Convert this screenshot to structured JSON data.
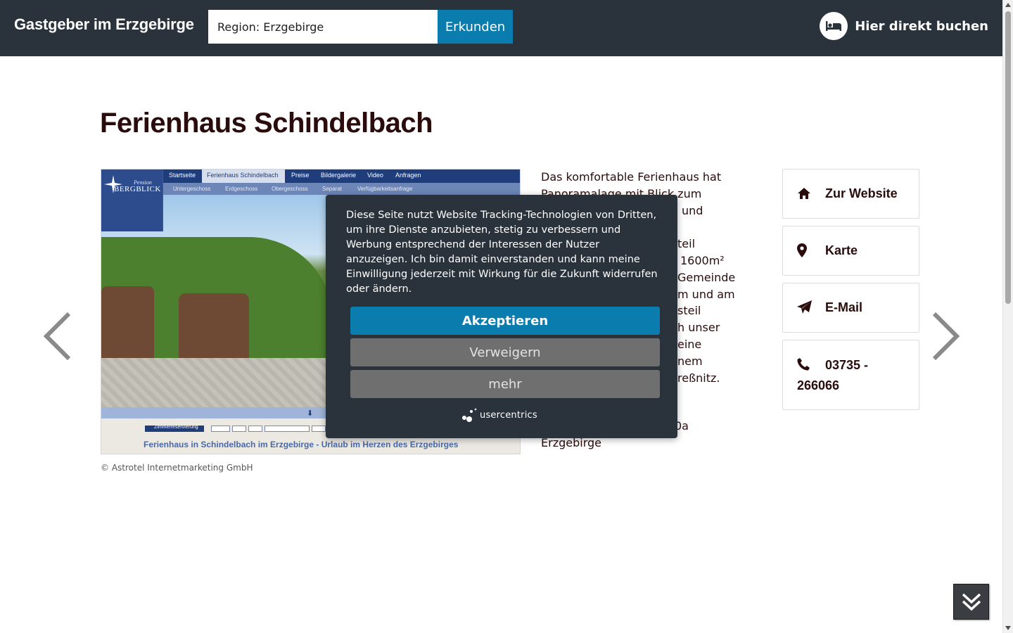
{
  "header": {
    "brand": "Gastgeber im Erzgebirge",
    "search_value": "Region: Erzgebirge",
    "search_button": "Erkunden",
    "book_label": "Hier direkt buchen"
  },
  "main": {
    "title": "Ferienhaus Schindelbach",
    "copyright": "© Astrotel Internetmarketing GmbH",
    "description_visible_lines": [
      "Das komfortable Ferienhaus hat",
      "Panoramalage mit Blick zum",
      "und",
      "",
      "teil",
      "1600m²",
      "Gemeinde",
      "m und am",
      "steil",
      "h unser",
      "eine",
      "nem",
      "reßnitz."
    ],
    "address_visible_lines": [
      "0a",
      "Erzgebirge"
    ]
  },
  "preview": {
    "nav_top": [
      "Startseite",
      "Ferienhaus Schindelbach",
      "Preise",
      "Bildergalerie",
      "Video",
      "Anfragen"
    ],
    "nav_sub": [
      "Untergeschoss",
      "Erdgeschoss",
      "Obergeschoss",
      "Separat",
      "Verfügbarkeitsanfrage"
    ],
    "logo_small": "Pension",
    "logo_big": "BERGBLICK",
    "booking_label": "Zimmerreservierung",
    "caption": "Ferienhaus in Schindelbach im Erzgebirge - Urlaub im Herzen des Erzgebirges"
  },
  "contact": {
    "website": "Zur Website",
    "map": "Karte",
    "email": "E-Mail",
    "phone": "03735 - 266066"
  },
  "cookie": {
    "text": "Diese Seite nutzt Website Tracking-Technologien von Dritten, um ihre Dienste anzubieten, stetig zu verbessern und Werbung entsprechend der Interessen der Nutzer anzuzeigen. Ich bin damit einverstanden und kann meine Einwilligung jederzeit mit Wirkung für die Zukunft widerrufen oder ändern.",
    "accept": "Akzeptieren",
    "deny": "Verweigern",
    "more": "mehr",
    "brand": "usercentrics"
  },
  "colors": {
    "header_bg": "#2a323b",
    "accent": "#0a7dae",
    "title_text": "#2b0c0c",
    "cookie_secondary": "#6f6f6f"
  }
}
